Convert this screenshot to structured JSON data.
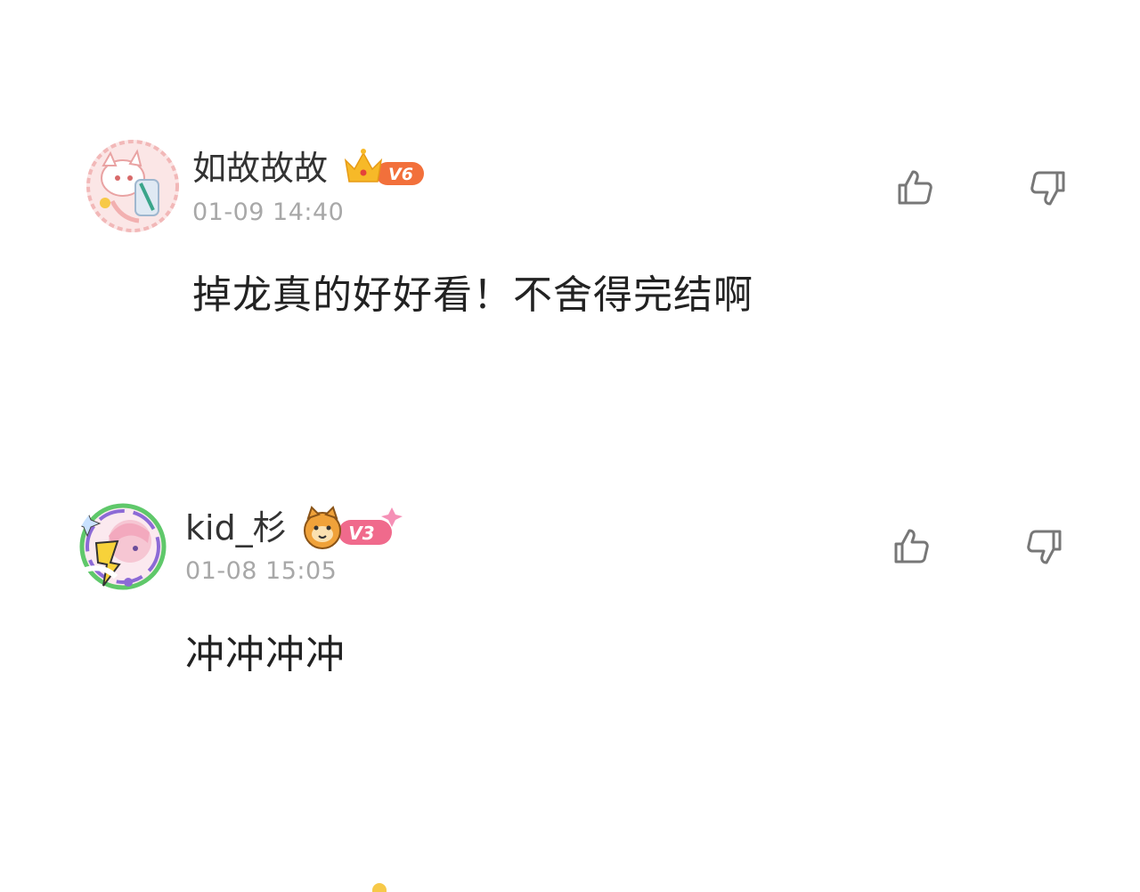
{
  "comments": [
    {
      "username": "如故故故",
      "level_badge": "V6",
      "timestamp": "01-09 14:40",
      "text": "掉龙真的好好看！不舍得完结啊",
      "badge_colors": {
        "crown": "#f7b928",
        "pill": "#f2703b"
      }
    },
    {
      "username": "kid_杉",
      "level_badge": "V3",
      "timestamp": "01-08 15:05",
      "text": "冲冲冲冲",
      "badge_colors": {
        "mascot": "#f0a23a",
        "pill": "#f06a8c"
      }
    }
  ],
  "icons": {
    "like": "thumbs-up-icon",
    "dislike": "thumbs-down-icon"
  }
}
